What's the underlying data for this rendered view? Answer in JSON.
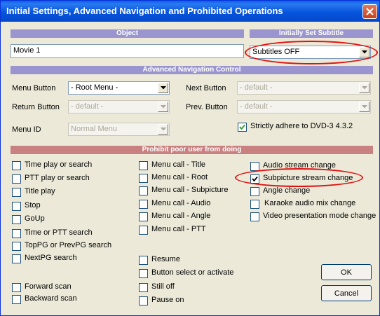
{
  "window": {
    "title": "Initial Settings, Advanced Navigation and Prohibited Operations"
  },
  "sections": {
    "object": "Object",
    "subtitle": "Initially Set Subtitle",
    "advanced": "Advanced Navigation Control",
    "prohibit": "Prohibit poor user from doing"
  },
  "object_value": "Movie 1",
  "subtitle_select": {
    "value": "Subtitles OFF"
  },
  "nav": {
    "menu_button_label": "Menu Button",
    "menu_button_value": "- Root Menu -",
    "next_button_label": "Next Button",
    "next_button_value": "- default -",
    "return_button_label": "Return Button",
    "return_button_value": "- default -",
    "prev_button_label": "Prev. Button",
    "prev_button_value": "- default -",
    "menu_id_label": "Menu ID",
    "menu_id_value": "Normal Menu",
    "strict_label": "Strictly adhere to DVD-3 4.3.2",
    "strict_checked": true
  },
  "prohibit": {
    "col1": [
      {
        "label": "Time play or search",
        "checked": false
      },
      {
        "label": "PTT play or search",
        "checked": false
      },
      {
        "label": "Title play",
        "checked": false
      },
      {
        "label": "Stop",
        "checked": false
      },
      {
        "label": "GoUp",
        "checked": false
      },
      {
        "label": "Time or PTT search",
        "checked": false
      },
      {
        "label": "TopPG or PrevPG search",
        "checked": false
      },
      {
        "label": "NextPG search",
        "checked": false
      }
    ],
    "col1_bottom": [
      {
        "label": "Forward scan",
        "checked": false
      },
      {
        "label": "Backward scan",
        "checked": false
      }
    ],
    "col2": [
      {
        "label": "Menu call - Title",
        "checked": false
      },
      {
        "label": "Menu call - Root",
        "checked": false
      },
      {
        "label": "Menu call - Subpicture",
        "checked": false
      },
      {
        "label": "Menu call - Audio",
        "checked": false
      },
      {
        "label": "Menu call - Angle",
        "checked": false
      },
      {
        "label": "Menu call - PTT",
        "checked": false
      }
    ],
    "col2_bottom": [
      {
        "label": "Resume",
        "checked": false
      },
      {
        "label": "Button select or activate",
        "checked": false
      },
      {
        "label": "Still off",
        "checked": false
      },
      {
        "label": "Pause on",
        "checked": false
      }
    ],
    "col3": [
      {
        "label": "Audio stream change",
        "checked": false
      },
      {
        "label": "Subpicture stream change",
        "checked": true
      },
      {
        "label": "Angle change",
        "checked": false
      },
      {
        "label": "Karaoke audio mix change",
        "checked": false
      },
      {
        "label": "Video presentation mode change",
        "checked": false
      }
    ]
  },
  "buttons": {
    "ok": "OK",
    "cancel": "Cancel"
  },
  "colors": {
    "title_bar": "#0754dd",
    "section_blue": "#9a95cf",
    "section_red": "#c98080",
    "highlight": "#e01010"
  }
}
